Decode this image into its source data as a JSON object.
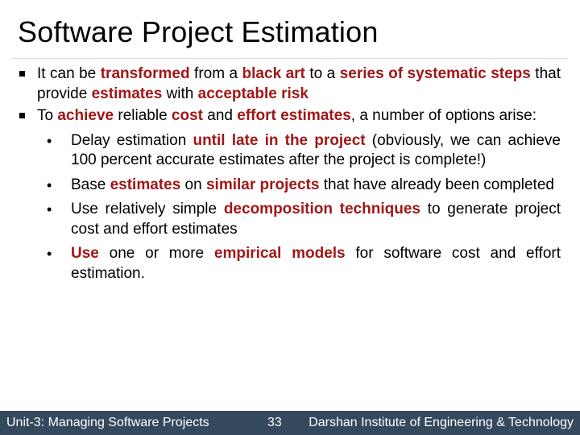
{
  "slide": {
    "title": "Software Project Estimation",
    "bullets": [
      {
        "segments": [
          {
            "text": "It can be ",
            "emph": false
          },
          {
            "text": "transformed",
            "emph": true
          },
          {
            "text": " from a ",
            "emph": false
          },
          {
            "text": "black art",
            "emph": true
          },
          {
            "text": " to a ",
            "emph": false
          },
          {
            "text": "series of systematic steps",
            "emph": true
          },
          {
            "text": " that provide ",
            "emph": false
          },
          {
            "text": "estimates",
            "emph": true
          },
          {
            "text": " with ",
            "emph": false
          },
          {
            "text": "acceptable risk",
            "emph": true
          }
        ]
      },
      {
        "segments": [
          {
            "text": "To ",
            "emph": false
          },
          {
            "text": "achieve",
            "emph": true
          },
          {
            "text": " reliable ",
            "emph": false
          },
          {
            "text": "cost",
            "emph": true
          },
          {
            "text": " and ",
            "emph": false
          },
          {
            "text": "effort estimates",
            "emph": true
          },
          {
            "text": ", a number of options arise:",
            "emph": false
          }
        ],
        "sub_bullets": [
          {
            "segments": [
              {
                "text": "Delay estimation ",
                "emph": false
              },
              {
                "text": "until late in the project",
                "emph": true
              },
              {
                "text": " (obviously, we can achieve 100 percent accurate estimates after the project is complete!)",
                "emph": false
              }
            ]
          },
          {
            "segments": [
              {
                "text": "Base ",
                "emph": false
              },
              {
                "text": "estimates",
                "emph": true
              },
              {
                "text": " on ",
                "emph": false
              },
              {
                "text": "similar projects",
                "emph": true
              },
              {
                "text": " that have already been completed",
                "emph": false
              }
            ]
          },
          {
            "segments": [
              {
                "text": "Use relatively simple ",
                "emph": false
              },
              {
                "text": "decomposition techniques",
                "emph": true
              },
              {
                "text": " to generate project cost and effort estimates",
                "emph": false
              }
            ]
          },
          {
            "segments": [
              {
                "text": "Use",
                "emph": true
              },
              {
                "text": " one or more ",
                "emph": false
              },
              {
                "text": "empirical models",
                "emph": true
              },
              {
                "text": " for software cost and effort estimation.",
                "emph": false
              }
            ]
          }
        ]
      }
    ]
  },
  "footer": {
    "unit": "Unit-3: Managing Software Projects",
    "page_number": "33",
    "institute": "Darshan Institute of Engineering & Technology"
  },
  "colors": {
    "emphasis": "#a01717",
    "footer_background": "#34495e",
    "footer_text": "#ffffff",
    "body_text": "#000000"
  }
}
